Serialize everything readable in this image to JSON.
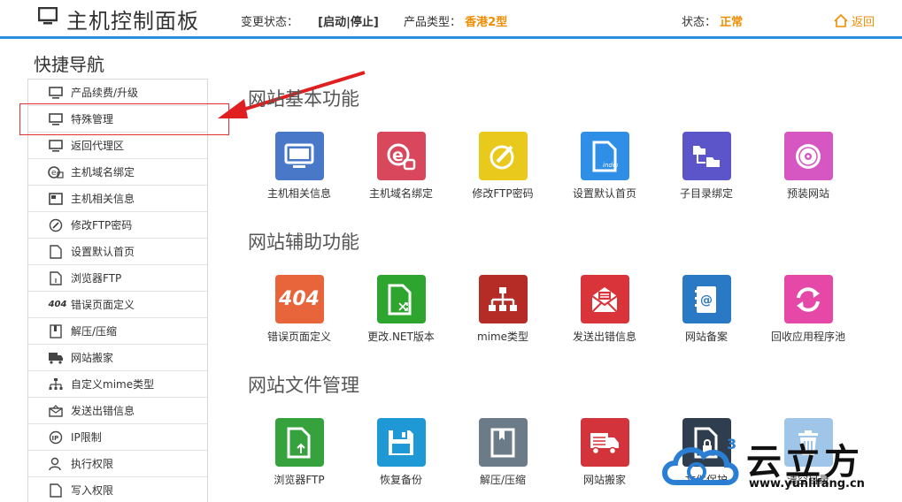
{
  "header": {
    "title": "主机控制面板",
    "change_status_label": "变更状态：",
    "change_status_value": "[启动|停止]",
    "product_type_label": "产品类型：",
    "product_type_value": "香港2型",
    "status_label": "状态：",
    "status_value": "正常",
    "back_label": "返回"
  },
  "sidebar": {
    "title": "快捷导航",
    "items": [
      {
        "label": "产品续费/升级",
        "icon": "monitor-icon"
      },
      {
        "label": "特殊管理",
        "icon": "monitor-icon"
      },
      {
        "label": "返回代理区",
        "icon": "monitor-icon"
      },
      {
        "label": "主机域名绑定",
        "icon": "domain-icon"
      },
      {
        "label": "主机相关信息",
        "icon": "info-icon"
      },
      {
        "label": "修改FTP密码",
        "icon": "edit-icon"
      },
      {
        "label": "设置默认首页",
        "icon": "file-icon"
      },
      {
        "label": "浏览器FTP",
        "icon": "file-icon"
      },
      {
        "label": "错误页面定义",
        "icon": "404-icon",
        "prefix": "404"
      },
      {
        "label": "解压/压缩",
        "icon": "archive-icon"
      },
      {
        "label": "网站搬家",
        "icon": "truck-icon"
      },
      {
        "label": "自定义mime类型",
        "icon": "tree-icon"
      },
      {
        "label": "发送出错信息",
        "icon": "mail-icon"
      },
      {
        "label": "IP限制",
        "icon": "ip-icon"
      },
      {
        "label": "执行权限",
        "icon": "user-icon"
      },
      {
        "label": "写入权限",
        "icon": "file-icon"
      }
    ]
  },
  "sections": [
    {
      "title": "网站基本功能",
      "tiles": [
        {
          "label": "主机相关信息",
          "icon": "monitor-icon",
          "color": "#4a78c8"
        },
        {
          "label": "主机域名绑定",
          "icon": "domain-icon",
          "color": "#d9475c"
        },
        {
          "label": "修改FTP密码",
          "icon": "edit-icon",
          "color": "#e8c91c"
        },
        {
          "label": "设置默认首页",
          "icon": "index-file-icon",
          "color": "#2f8fe6"
        },
        {
          "label": "子目录绑定",
          "icon": "folder-tree-icon",
          "color": "#5b55c9"
        },
        {
          "label": "预装网站",
          "icon": "disc-icon",
          "color": "#d657c2"
        }
      ]
    },
    {
      "title": "网站辅助功能",
      "tiles": [
        {
          "label": "错误页面定义",
          "icon": "404-icon",
          "color": "#e8643a",
          "text": "404"
        },
        {
          "label": "更改.NET版本",
          "icon": "file-switch-icon",
          "color": "#2ea52e"
        },
        {
          "label": "mime类型",
          "icon": "tree-icon",
          "color": "#b52b26"
        },
        {
          "label": "发送出错信息",
          "icon": "mail-icon",
          "color": "#d9343a"
        },
        {
          "label": "网站备案",
          "icon": "contact-book-icon",
          "color": "#2a79c4"
        },
        {
          "label": "回收应用程序池",
          "icon": "refresh-icon",
          "color": "#e548a6"
        }
      ]
    },
    {
      "title": "网站文件管理",
      "tiles": [
        {
          "label": "浏览器FTP",
          "icon": "upload-file-icon",
          "color": "#35a23d"
        },
        {
          "label": "恢复备份",
          "icon": "save-icon",
          "color": "#1f98d6"
        },
        {
          "label": "解压/压缩",
          "icon": "book-icon",
          "color": "#6b7b88"
        },
        {
          "label": "网站搬家",
          "icon": "truck-icon",
          "color": "#d3333a"
        },
        {
          "label": "文件保护",
          "icon": "lock-file-icon",
          "color": "#2f3e4e"
        },
        {
          "label": "清空目录",
          "icon": "trash-icon",
          "color": "#9fc6e8"
        }
      ]
    }
  ],
  "watermark": {
    "title": "云立方",
    "url": "www.yunlifang.cn"
  }
}
